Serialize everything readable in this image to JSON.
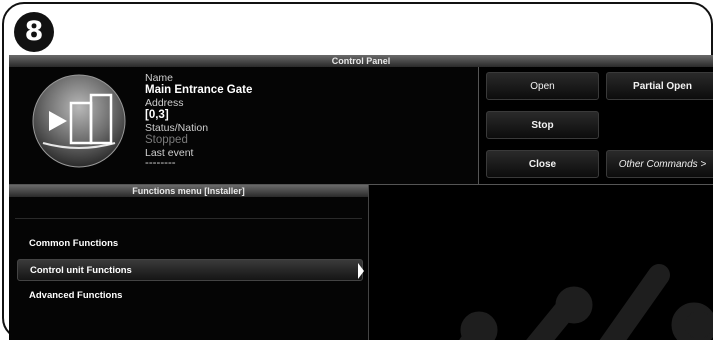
{
  "step_badge": "8",
  "control_panel": {
    "title": "Control Panel",
    "device": {
      "name_label": "Name",
      "name_value": "Main Entrance Gate",
      "address_label": "Address",
      "address_value": "[0,3]",
      "status_label": "Status/Nation",
      "status_value": "Stopped",
      "last_event_label": "Last event",
      "last_event_value": "--------"
    },
    "commands": {
      "open": "Open",
      "partial_open": "Partial Open",
      "stop": "Stop",
      "close": "Close",
      "other_commands": "Other Commands >"
    }
  },
  "functions_menu": {
    "title": "Functions menu [Installer]",
    "items": [
      {
        "label": "Common Functions"
      },
      {
        "label": "Control unit Functions",
        "selected": true
      },
      {
        "label": "Advanced Functions"
      }
    ]
  },
  "colors": {
    "background": "#000000",
    "header_bar": "#4a4a4a",
    "text": "#ffffff",
    "status_dim": "#7a7a7a"
  }
}
